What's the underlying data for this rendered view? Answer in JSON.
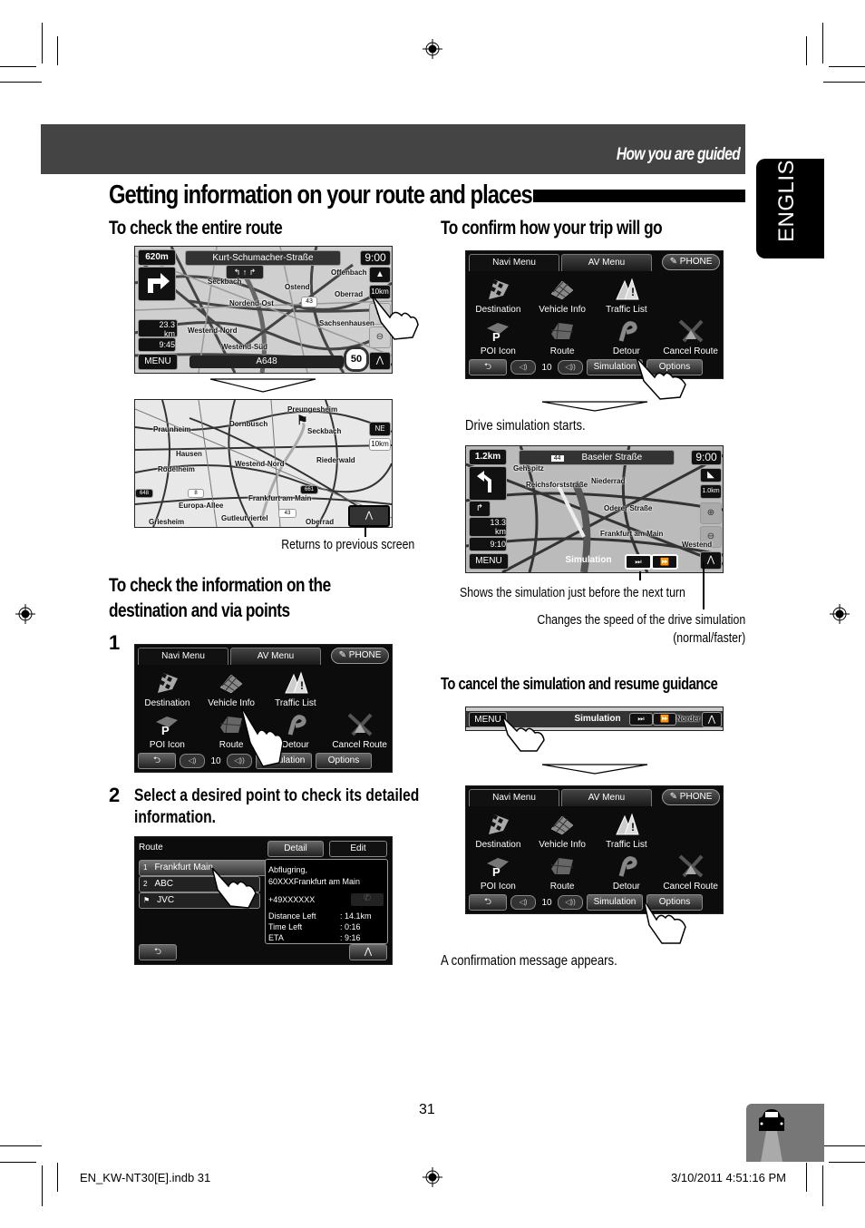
{
  "header": {
    "section": "How you are guided",
    "title": "Getting information on your route and places",
    "language_tab": "ENGLISH"
  },
  "left": {
    "sec1_heading": "To check the entire route",
    "map1": {
      "distance": "620m",
      "street": "Kurt-Schumacher-Straße",
      "clock": "9:00",
      "scale": "10km",
      "remaining_dist": "23.3",
      "remaining_unit": "km",
      "eta": "9:45",
      "menu": "MENU",
      "road": "A648",
      "speed_limit": "50",
      "road_shield": "43",
      "labels": [
        "Seckbach",
        "Offenbach",
        "Ostend",
        "Oberrad",
        "Nordend-Ost",
        "Sachsenhausen",
        "Westend-Nord",
        "Westend-Süd"
      ]
    },
    "map2": {
      "compass": "NE",
      "scale": "10km",
      "labels": [
        "Preungesheim",
        "Praunheim",
        "Dornbusch",
        "Seckbach",
        "Hausen",
        "Rödelheim",
        "Westend-Nord",
        "Riederwald",
        "Frankfurt am Main",
        "Europa-Allee",
        "Gutleutviertel",
        "Griesheim",
        "Oberrad"
      ],
      "shields": [
        "648",
        "8",
        "661",
        "43"
      ]
    },
    "map2_caption": "Returns to previous screen",
    "sec2_heading_line1": "To check the information on the",
    "sec2_heading_line2": "destination and via points",
    "step1_num": "1",
    "step2_num": "2",
    "step2_text_line1": "Select a desired point to check its detailed",
    "step2_text_line2": "information.",
    "route_screen": {
      "title": "Route",
      "detail_btn": "Detail",
      "edit_btn": "Edit",
      "points": [
        {
          "num": "1",
          "name": "Frankfurt Main"
        },
        {
          "num": "2",
          "name": "ABC"
        },
        {
          "num": "⚑",
          "name": "JVC"
        }
      ],
      "address_line1": "Abflugring,",
      "address_line2": "60XXXFrankfurt am Main",
      "phone": "+49XXXXXX",
      "info": [
        {
          "label": "Distance Left",
          "value": ": 14.1km"
        },
        {
          "label": "Time Left",
          "value": ": 0:16"
        },
        {
          "label": "ETA",
          "value": ": 9:16"
        }
      ]
    }
  },
  "menu_screen": {
    "tabs": [
      "Navi Menu",
      "AV Menu",
      "PHONE"
    ],
    "items": [
      "Destination",
      "Vehicle Info",
      "Traffic List",
      "",
      "POI Icon",
      "Route",
      "Detour",
      "Cancel Route"
    ],
    "volume": "10",
    "simulation_btn": "Simulation",
    "options_btn": "Options"
  },
  "right": {
    "sec1_heading": "To confirm how your trip will go",
    "sim_caption": "Drive simulation starts.",
    "sim_map": {
      "distance": "1.2km",
      "road_no": "44",
      "street": "Baseler Straße",
      "clock": "9:00",
      "scale": "1.0km",
      "remaining_dist": "13.3",
      "remaining_unit": "km",
      "eta": "9:10",
      "menu": "MENU",
      "simulation": "Simulation",
      "labels": [
        "Gehspitz",
        "Niederrad",
        "Reichsforststraße",
        "Oderer Straße",
        "Frankfurt am Main",
        "Westend"
      ]
    },
    "callout1": "Shows the simulation just before the next turn",
    "callout2_line1": "Changes the speed of the drive simulation",
    "callout2_line2": "(normal/faster)",
    "sec2_heading": "To cancel the simulation and resume guidance",
    "strip": {
      "menu": "MENU",
      "simulation": "Simulation",
      "label": "Norder"
    },
    "confirm_caption": "A confirmation message appears."
  },
  "footer": {
    "page_number": "31",
    "file": "EN_KW-NT30[E].indb   31",
    "datetime": "3/10/2011   4:51:16 PM"
  }
}
